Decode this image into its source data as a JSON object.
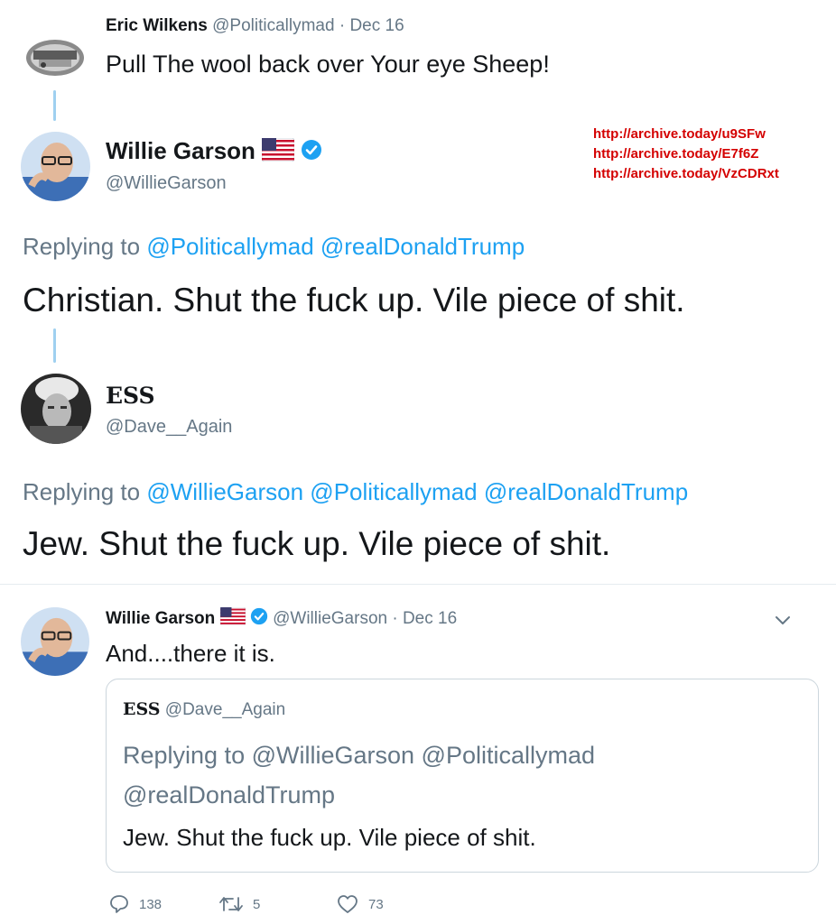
{
  "tweet1": {
    "name": "Eric Wilkens",
    "handle": "@Politicallymad",
    "date": "· Dec 16",
    "text": "Pull The wool back over Your eye Sheep!"
  },
  "tweet2": {
    "name": "Willie Garson",
    "handle": "@WillieGarson",
    "replying_prefix": "Replying to",
    "replying_mentions": "@Politicallymad @realDonaldTrump",
    "text": "Christian. Shut the fuck up. Vile piece of shit."
  },
  "archive_links": [
    "http://archive.today/u9SFw",
    "http://archive.today/E7f6Z",
    "http://archive.today/VzCDRxt"
  ],
  "tweet3": {
    "name": "ESS",
    "handle": "@Dave__Again",
    "replying_prefix": "Replying to",
    "replying_mentions": "@WillieGarson @Politicallymad @realDonaldTrump",
    "text": "Jew. Shut the fuck up. Vile piece of shit."
  },
  "tweet4": {
    "name": "Willie Garson",
    "handle": "@WillieGarson",
    "date": "· Dec 16",
    "text": "And....there it is.",
    "quoted": {
      "name": "ESS",
      "handle": "@Dave__Again",
      "replying_prefix": "Replying to",
      "replying_line1": "@WillieGarson @Politicallymad",
      "replying_line2": "@realDonaldTrump",
      "text": "Jew. Shut the fuck up. Vile piece of shit."
    },
    "actions": {
      "replies": "138",
      "retweets": "5",
      "likes": "73"
    }
  },
  "colors": {
    "link_blue": "#1da1f2",
    "archive_red": "#d40000",
    "secondary_grey": "#657786"
  }
}
